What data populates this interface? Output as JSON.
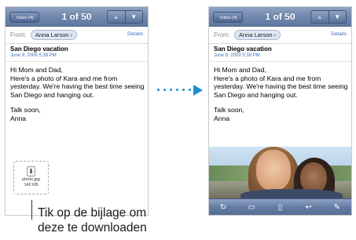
{
  "left_screen": {
    "navbar": {
      "inbox_label": "Inbox (4)",
      "counter": "1 of 50",
      "up_icon": "up-arrow",
      "down_icon": "down-arrow"
    },
    "from_label": "From:",
    "sender": "Anna Larson",
    "details_label": "Details",
    "subject": "San Diego vacation",
    "date": "June 9, 2009 5:39 PM",
    "body": [
      "Hi Mom and Dad,\nHere's a photo of Kara and me from yesterday. We're having the best time seeing San Diego and hanging out.",
      "Talk soon,\nAnna"
    ],
    "attachment": {
      "icon": "download-icon",
      "name": "photo.jpg",
      "size": "142 KB"
    }
  },
  "right_screen": {
    "navbar": {
      "inbox_label": "Inbox (4)",
      "counter": "1 of 50",
      "up_icon": "up-arrow",
      "down_icon": "down-arrow"
    },
    "from_label": "From:",
    "sender": "Anna Larson",
    "details_label": "Details",
    "subject": "San Diego vacation",
    "date": "June 9, 2009 5:39 PM",
    "body": [
      "Hi Mom and Dad,\nHere's a photo of Kara and me from yesterday. We're having the best time seeing San Diego and hanging out.",
      "Talk soon,\nAnna"
    ],
    "toolbar_icons": [
      "refresh-icon",
      "move-folder-icon",
      "trash-icon",
      "reply-icon",
      "compose-icon"
    ]
  },
  "caption": "Tik op de bijlage om\ndeze te downloaden",
  "colors": {
    "navbar": "#6f86ad",
    "link": "#3c6fc1",
    "arrow": "#1b8fd6"
  }
}
